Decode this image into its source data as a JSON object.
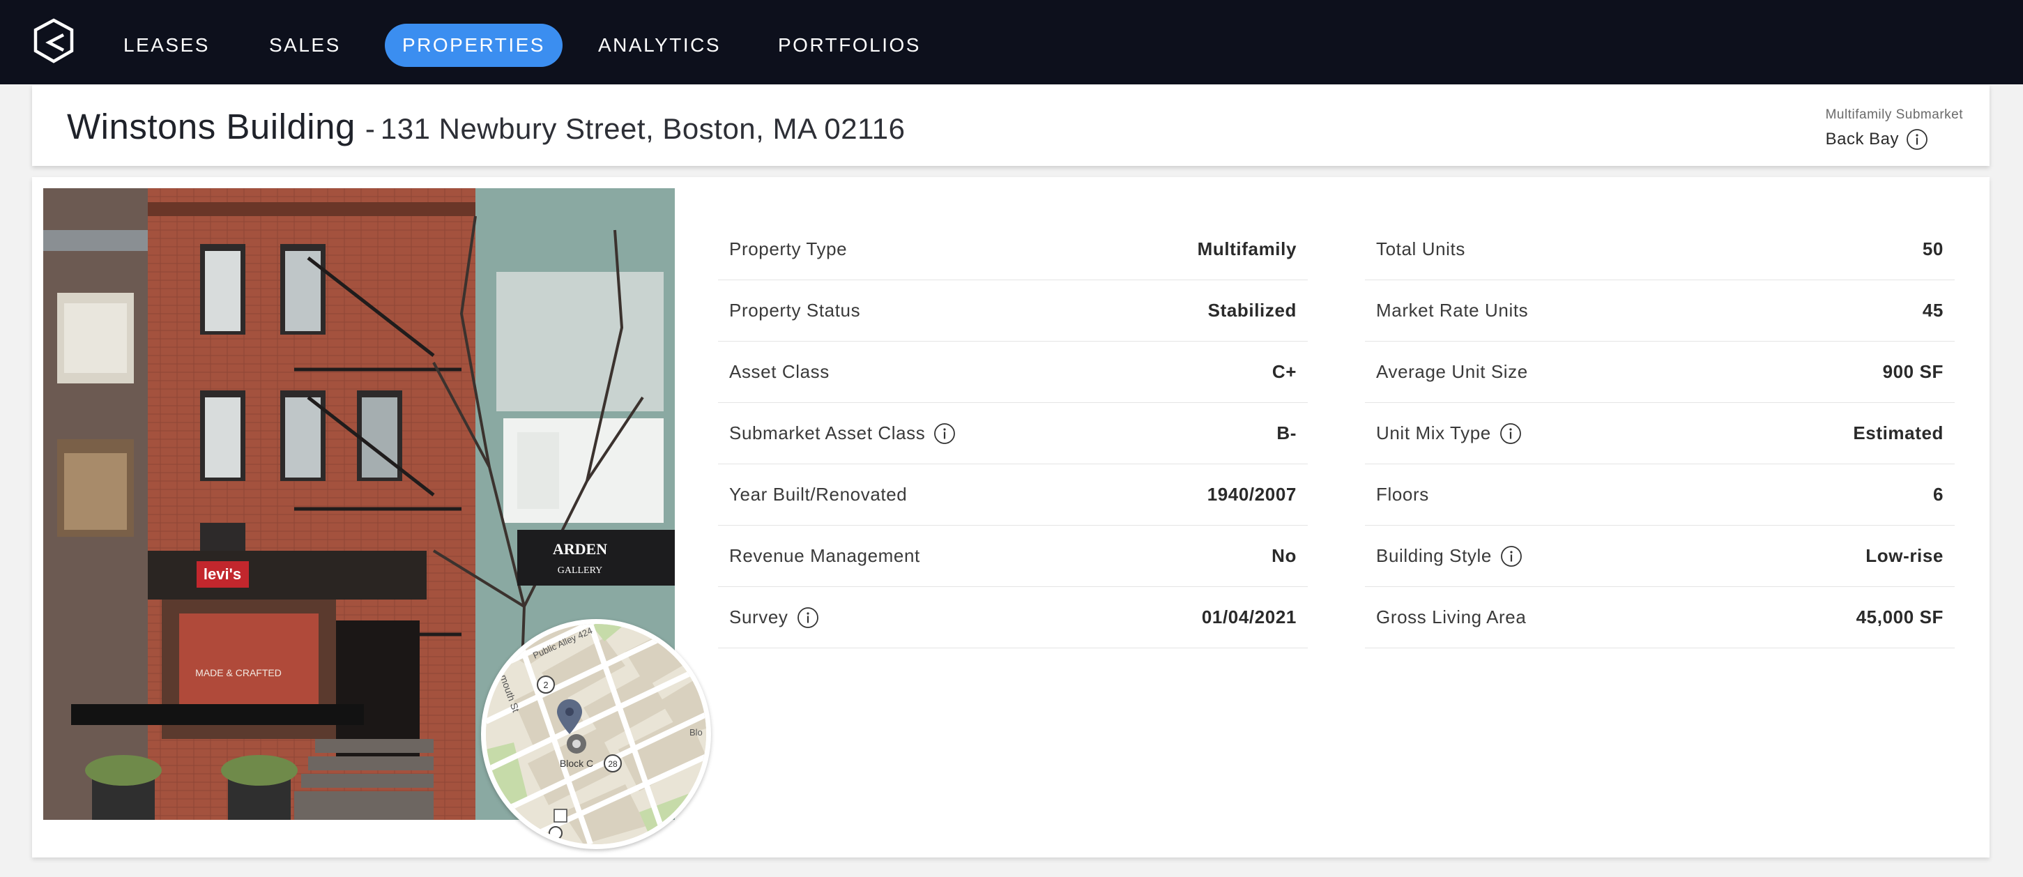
{
  "nav": {
    "items": [
      {
        "label": "LEASES"
      },
      {
        "label": "SALES"
      },
      {
        "label": "PROPERTIES",
        "active": true
      },
      {
        "label": "ANALYTICS"
      },
      {
        "label": "PORTFOLIOS"
      }
    ],
    "logo_icon": "building-logo-icon",
    "active_color": "#3b8ef0",
    "background": "#0d101c"
  },
  "header": {
    "name": "Winstons Building",
    "separator": "-",
    "address": "131 Newbury Street, Boston, MA 02116",
    "submarket_label": "Multifamily Submarket",
    "submarket_value": "Back Bay"
  },
  "photo": {
    "storefront_sign": "levi's",
    "gallery_sign_1": "ARDEN",
    "gallery_sign_2": "GALLERY",
    "window_text": "MADE & CRAFTED"
  },
  "map": {
    "street_1": "Public Alley 424",
    "street_2": "mouth St",
    "street_3": "Blo",
    "block_label": "Block C",
    "route_a": "2",
    "route_b": "28"
  },
  "details_left": [
    {
      "label": "Property Type",
      "value": "Multifamily",
      "info": false
    },
    {
      "label": "Property Status",
      "value": "Stabilized",
      "info": false
    },
    {
      "label": "Asset Class",
      "value": "C+",
      "info": false
    },
    {
      "label": "Submarket Asset Class",
      "value": "B-",
      "info": true
    },
    {
      "label": "Year Built/Renovated",
      "value": "1940/2007",
      "info": false
    },
    {
      "label": "Revenue Management",
      "value": "No",
      "info": false
    },
    {
      "label": "Survey",
      "value": "01/04/2021",
      "info": true
    }
  ],
  "details_right": [
    {
      "label": "Total Units",
      "value": "50",
      "info": false
    },
    {
      "label": "Market Rate Units",
      "value": "45",
      "info": false
    },
    {
      "label": "Average Unit Size",
      "value": "900 SF",
      "info": false
    },
    {
      "label": "Unit Mix Type",
      "value": "Estimated",
      "info": true
    },
    {
      "label": "Floors",
      "value": "6",
      "info": false
    },
    {
      "label": "Building Style",
      "value": "Low-rise",
      "info": true
    },
    {
      "label": "Gross Living Area",
      "value": "45,000 SF",
      "info": false
    }
  ]
}
